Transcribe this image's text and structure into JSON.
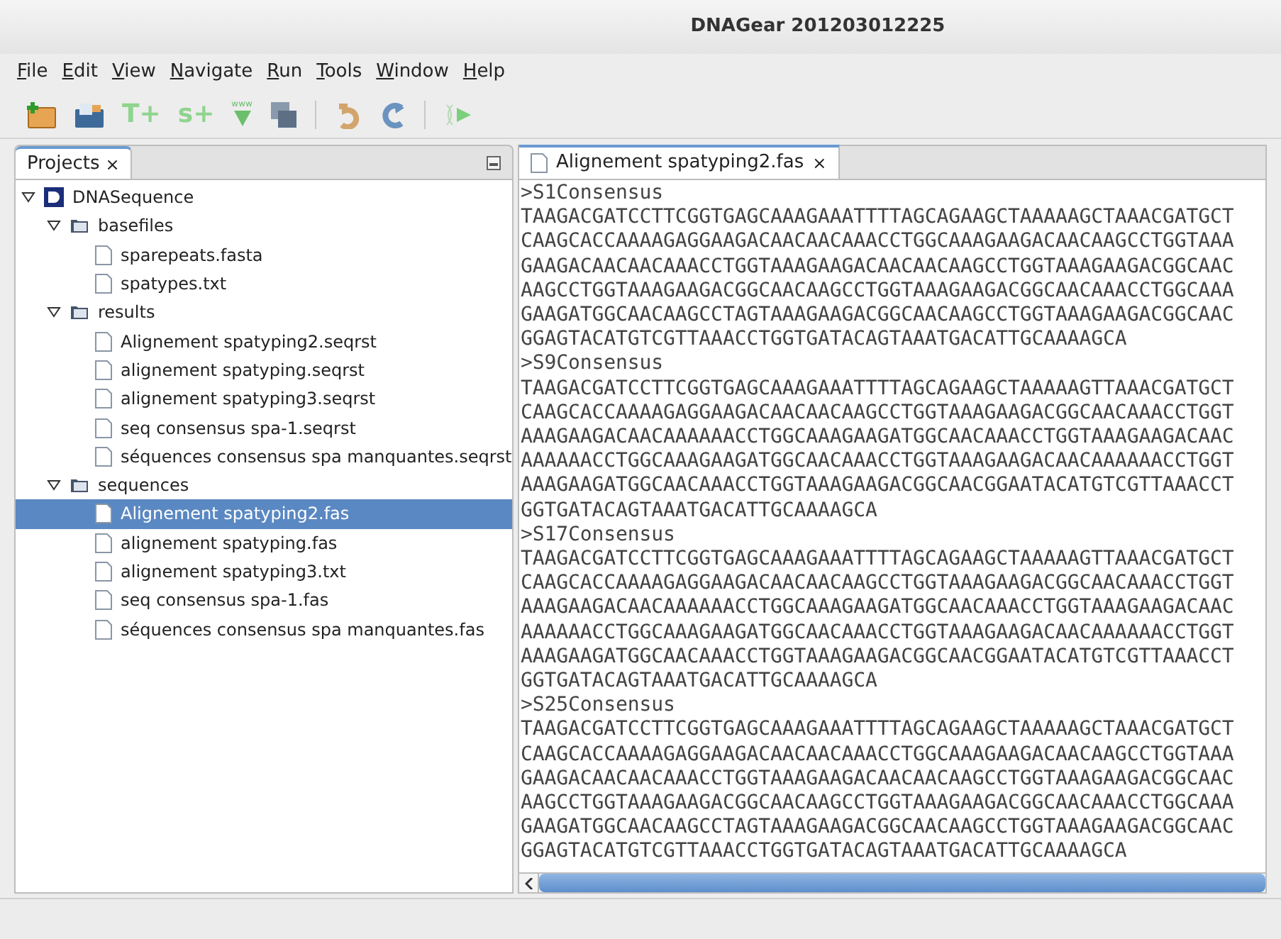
{
  "window": {
    "title": "DNAGear 201203012225"
  },
  "menu": [
    "File",
    "Edit",
    "View",
    "Navigate",
    "Run",
    "Tools",
    "Window",
    "Help"
  ],
  "toolbar": [
    {
      "kind": "new-project"
    },
    {
      "kind": "open-project"
    },
    {
      "kind": "text",
      "label": "T+"
    },
    {
      "kind": "text",
      "label": "s+"
    },
    {
      "kind": "download",
      "label": "www"
    },
    {
      "kind": "save"
    },
    {
      "kind": "separator"
    },
    {
      "kind": "undo"
    },
    {
      "kind": "redo"
    },
    {
      "kind": "separator"
    },
    {
      "kind": "run"
    }
  ],
  "projects_panel": {
    "tab": "Projects",
    "close": "×",
    "tree": [
      {
        "label": "DNASequence",
        "kind": "project",
        "expanded": true,
        "selected": false,
        "children": [
          {
            "label": "basefiles",
            "kind": "folder",
            "expanded": true,
            "selected": false,
            "children": [
              {
                "label": "sparepeats.fasta",
                "kind": "file",
                "selected": false
              },
              {
                "label": "spatypes.txt",
                "kind": "file",
                "selected": false
              }
            ]
          },
          {
            "label": "results",
            "kind": "folder",
            "expanded": true,
            "selected": false,
            "children": [
              {
                "label": "Alignement spatyping2.seqrst",
                "kind": "file",
                "selected": false
              },
              {
                "label": "alignement spatyping.seqrst",
                "kind": "file",
                "selected": false
              },
              {
                "label": "alignement spatyping3.seqrst",
                "kind": "file",
                "selected": false
              },
              {
                "label": "seq consensus spa-1.seqrst",
                "kind": "file",
                "selected": false
              },
              {
                "label": "séquences consensus spa manquantes.seqrst",
                "kind": "file",
                "selected": false
              }
            ]
          },
          {
            "label": "sequences",
            "kind": "folder",
            "expanded": true,
            "selected": false,
            "children": [
              {
                "label": "Alignement spatyping2.fas",
                "kind": "file",
                "selected": true
              },
              {
                "label": "alignement spatyping.fas",
                "kind": "file",
                "selected": false
              },
              {
                "label": "alignement spatyping3.txt",
                "kind": "file",
                "selected": false
              },
              {
                "label": "seq consensus spa-1.fas",
                "kind": "file",
                "selected": false
              },
              {
                "label": "séquences consensus spa manquantes.fas",
                "kind": "file",
                "selected": false
              }
            ]
          }
        ]
      }
    ]
  },
  "editor": {
    "tab": "Alignement spatyping2.fas",
    "close": "×",
    "lines": [
      ">S1Consensus",
      "TAAGACGATCCTTCGGTGAGCAAAGAAATTTTAGCAGAAGCTAAAAAGCTAAACGATGCT",
      "CAAGCACCAAAAGAGGAAGACAACAACAAACCTGGCAAAGAAGACAACAAGCCTGGTAAA",
      "GAAGACAACAACAAACCTGGTAAAGAAGACAACAACAAGCCTGGTAAAGAAGACGGCAAC",
      "AAGCCTGGTAAAGAAGACGGCAACAAGCCTGGTAAAGAAGACGGCAACAAACCTGGCAAA",
      "GAAGATGGCAACAAGCCTAGTAAAGAAGACGGCAACAAGCCTGGTAAAGAAGACGGCAAC",
      "GGAGTACATGTCGTTAAACCTGGTGATACAGTAAATGACATTGCAAAAGCA",
      ">S9Consensus",
      "TAAGACGATCCTTCGGTGAGCAAAGAAATTTTAGCAGAAGCTAAAAAGTTAAACGATGCT",
      "CAAGCACCAAAAGAGGAAGACAACAACAAGCCTGGTAAAGAAGACGGCAACAAACCTGGT",
      "AAAGAAGACAACAAAAAACCTGGCAAAGAAGATGGCAACAAACCTGGTAAAGAAGACAAC",
      "AAAAAACCTGGCAAAGAAGATGGCAACAAACCTGGTAAAGAAGACAACAAAAAACCTGGT",
      "AAAGAAGATGGCAACAAACCTGGTAAAGAAGACGGCAACGGAATACATGTCGTTAAACCT",
      "GGTGATACAGTAAATGACATTGCAAAAGCA",
      ">S17Consensus",
      "TAAGACGATCCTTCGGTGAGCAAAGAAATTTTAGCAGAAGCTAAAAAGTTAAACGATGCT",
      "CAAGCACCAAAAGAGGAAGACAACAACAAGCCTGGTAAAGAAGACGGCAACAAACCTGGT",
      "AAAGAAGACAACAAAAAACCTGGCAAAGAAGATGGCAACAAACCTGGTAAAGAAGACAAC",
      "AAAAAACCTGGCAAAGAAGATGGCAACAAACCTGGTAAAGAAGACAACAAAAAACCTGGT",
      "AAAGAAGATGGCAACAAACCTGGTAAAGAAGACGGCAACGGAATACATGTCGTTAAACCT",
      "GGTGATACAGTAAATGACATTGCAAAAGCA",
      ">S25Consensus",
      "TAAGACGATCCTTCGGTGAGCAAAGAAATTTTAGCAGAAGCTAAAAAGCTAAACGATGCT",
      "CAAGCACCAAAAGAGGAAGACAACAACAAACCTGGCAAAGAAGACAACAAGCCTGGTAAA",
      "GAAGACAACAACAAACCTGGTAAAGAAGACAACAACAAGCCTGGTAAAGAAGACGGCAAC",
      "AAGCCTGGTAAAGAAGACGGCAACAAGCCTGGTAAAGAAGACGGCAACAAACCTGGCAAA",
      "GAAGATGGCAACAAGCCTAGTAAAGAAGACGGCAACAAGCCTGGTAAAGAAGACGGCAAC",
      "GGAGTACATGTCGTTAAACCTGGTGATACAGTAAATGACATTGCAAAAGCA"
    ]
  }
}
